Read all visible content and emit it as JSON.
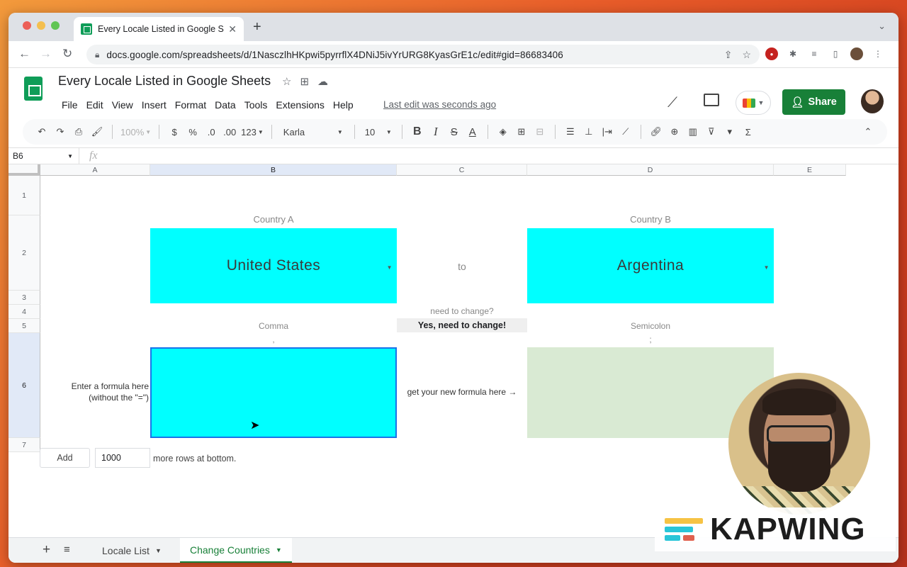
{
  "browser": {
    "tab_title": "Every Locale Listed in Google S",
    "url": "docs.google.com/spreadsheets/d/1NasczlhHKpwi5pyrrflX4DNiJ5ivYrURG8KyasGrE1c/edit#gid=86683406"
  },
  "sheets": {
    "doc_title": "Every Locale Listed in Google Sheets",
    "menu": [
      "File",
      "Edit",
      "View",
      "Insert",
      "Format",
      "Data",
      "Tools",
      "Extensions",
      "Help"
    ],
    "last_edit": "Last edit was seconds ago",
    "share_label": "Share",
    "toolbar": {
      "zoom": "100%",
      "currency": "$",
      "percent": "%",
      "dec_less": ".0",
      "dec_more": ".00",
      "more_formats": "123",
      "font": "Karla",
      "font_size": "10"
    },
    "name_box": "B6",
    "fx": "fx"
  },
  "grid": {
    "columns": [
      "A",
      "B",
      "C",
      "D",
      "E"
    ],
    "rows": [
      "1",
      "2",
      "3",
      "4",
      "5",
      "6",
      "7"
    ],
    "country_a_label": "Country A",
    "country_b_label": "Country B",
    "country_a": "United States",
    "country_b": "Argentina",
    "to_label": "to",
    "need_change_q": "need to change?",
    "need_change_a": "Yes, need to change!",
    "sep_a_name": "Comma",
    "sep_b_name": "Semicolon",
    "sep_a_char": ",",
    "sep_b_char": ";",
    "enter_formula_1": "Enter a formula here",
    "enter_formula_2": "(without the \"=\")",
    "get_formula": "get your new formula here →",
    "cyan_color": "#00ffff",
    "green_color": "#d9ead3"
  },
  "add_rows": {
    "button": "Add",
    "value": "1000",
    "label": "more rows at bottom."
  },
  "sheet_tabs": [
    {
      "label": "Locale List",
      "active": false
    },
    {
      "label": "Change Countries",
      "active": true
    }
  ],
  "overlay": {
    "brand": "KAPWING"
  }
}
